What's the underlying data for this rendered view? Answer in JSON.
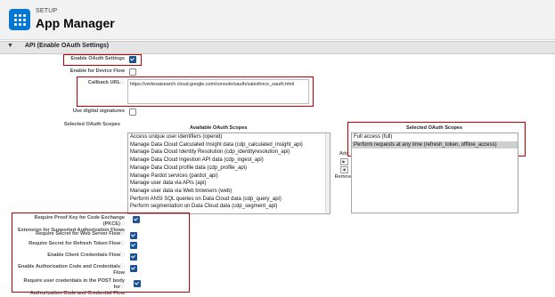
{
  "header": {
    "setup_label": "SETUP",
    "title": "App Manager"
  },
  "section": {
    "toggle": "▼",
    "title": "API (Enable OAuth Settings)"
  },
  "fields": {
    "enable_oauth": {
      "label": "Enable OAuth Settings",
      "checked": true
    },
    "device_flow": {
      "label": "Enable for Device Flow",
      "checked": false
    },
    "callback": {
      "label": "Callback URL",
      "value": "https://vertexaisearch.cloud.google.com/console/oauth/salesforce_oauth.html"
    },
    "digital_sig": {
      "label": "Use digital signatures",
      "checked": false
    },
    "scopes_label": "Selected OAuth Scopes"
  },
  "scopes": {
    "available_header": "Available OAuth Scopes",
    "selected_header": "Selected OAuth Scopes",
    "available": [
      "Access unique user identifiers (openid)",
      "Manage Data Cloud Calculated Insight data (cdp_calculated_insight_api)",
      "Manage Data Cloud Identity Resolution (cdp_identityresolution_api)",
      "Manage Data Cloud Ingestion API data (cdp_ingest_api)",
      "Manage Data Cloud profile data (cdp_profile_api)",
      "Manage Pardot services (pardot_api)",
      "Manage user data via APIs (api)",
      "Manage user data via Web browsers (web)",
      "Perform ANSI SQL queries on Data Cloud data (cdp_query_api)",
      "Perform segmentation on Data Cloud data (cdp_segment_api)"
    ],
    "selected": [
      "Full access (full)",
      "Perform requests at any time (refresh_token, offline_access)"
    ],
    "add_label": "Add",
    "remove_label": "Remove",
    "add_arrow": "▶",
    "remove_arrow": "◀"
  },
  "security": {
    "pkce_line1": "Require Proof Key for Code Exchange (PKCE)",
    "pkce_line2": "Extension for Supported Authorization Flows",
    "secret_web": "Require Secret for Web Server Flow",
    "secret_refresh": "Require Secret for Refresh Token Flow",
    "client_creds": "Enable Client Credentials Flow",
    "auth_code_line1": "Enable Authorization Code and Credentials",
    "auth_code_line2": "Flow",
    "post_body_line1": "Require user credentials in the POST body for",
    "post_body_line2": "Authorization Code and Credential Flow",
    "info_glyph": "ⓘ"
  },
  "colors": {
    "accent": "#0176d3",
    "checkbox": "#1b5297",
    "highlight_border": "#c00000"
  },
  "icons": {
    "app": "app-grid-icon",
    "info": "info-icon",
    "toggle": "chevron-down-icon"
  }
}
